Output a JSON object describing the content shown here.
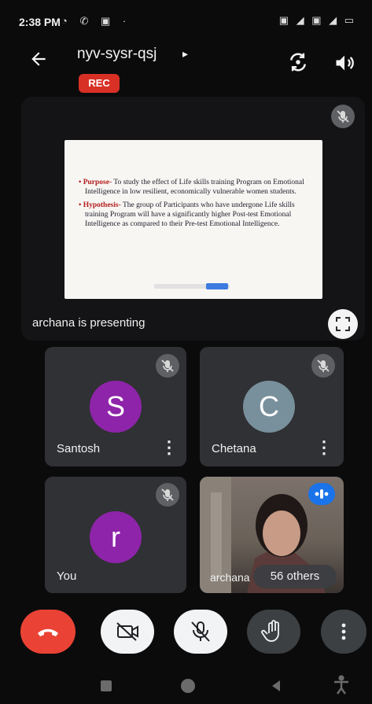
{
  "status_bar": {
    "time": "2:38 PM",
    "left_icons": "◔ ✆ ▣ ·",
    "right_icons": "▣ ◢ ▣ ◢ ▭"
  },
  "header": {
    "meeting_code": "nyv-sysr-qsj",
    "caret": "▸",
    "recording_badge": "REC",
    "back_icon": "arrow-left-icon",
    "switch_camera_icon": "switch-camera-icon",
    "speaker_icon": "volume-icon"
  },
  "presentation": {
    "label": "archana is presenting",
    "slide": {
      "bullets": [
        {
          "heading": "Purpose-",
          "text": " To study the effect of Life skills training Program on Emotional Intelligence in low resilient, economically vulnerable women students."
        },
        {
          "heading": "Hypothesis-",
          "text": " The group of Participants who have undergone Life skills training Program will have a significantly higher Post-test Emotional Intelligence as compared to their Pre-test Emotional Intelligence."
        }
      ]
    }
  },
  "participants": [
    {
      "name": "Santosh",
      "initial": "S",
      "avatar_color": "#8e24aa",
      "muted": true
    },
    {
      "name": "Chetana",
      "initial": "C",
      "avatar_color": "#78909c",
      "muted": true
    },
    {
      "name": "You",
      "initial": "r",
      "avatar_color": "#8e24aa",
      "muted": true
    },
    {
      "name": "archana",
      "others_label": "56 others",
      "speaking": true
    }
  ],
  "controls": {
    "end_call": "end-call-icon",
    "camera": "camera-off-icon",
    "microphone": "mic-off-icon",
    "raise_hand": "raise-hand-icon",
    "more": "more-vert-icon"
  },
  "colors": {
    "end_call": "#ea4335",
    "rec": "#d93025",
    "tile_bg": "#303134",
    "speaking": "#1a73e8"
  }
}
